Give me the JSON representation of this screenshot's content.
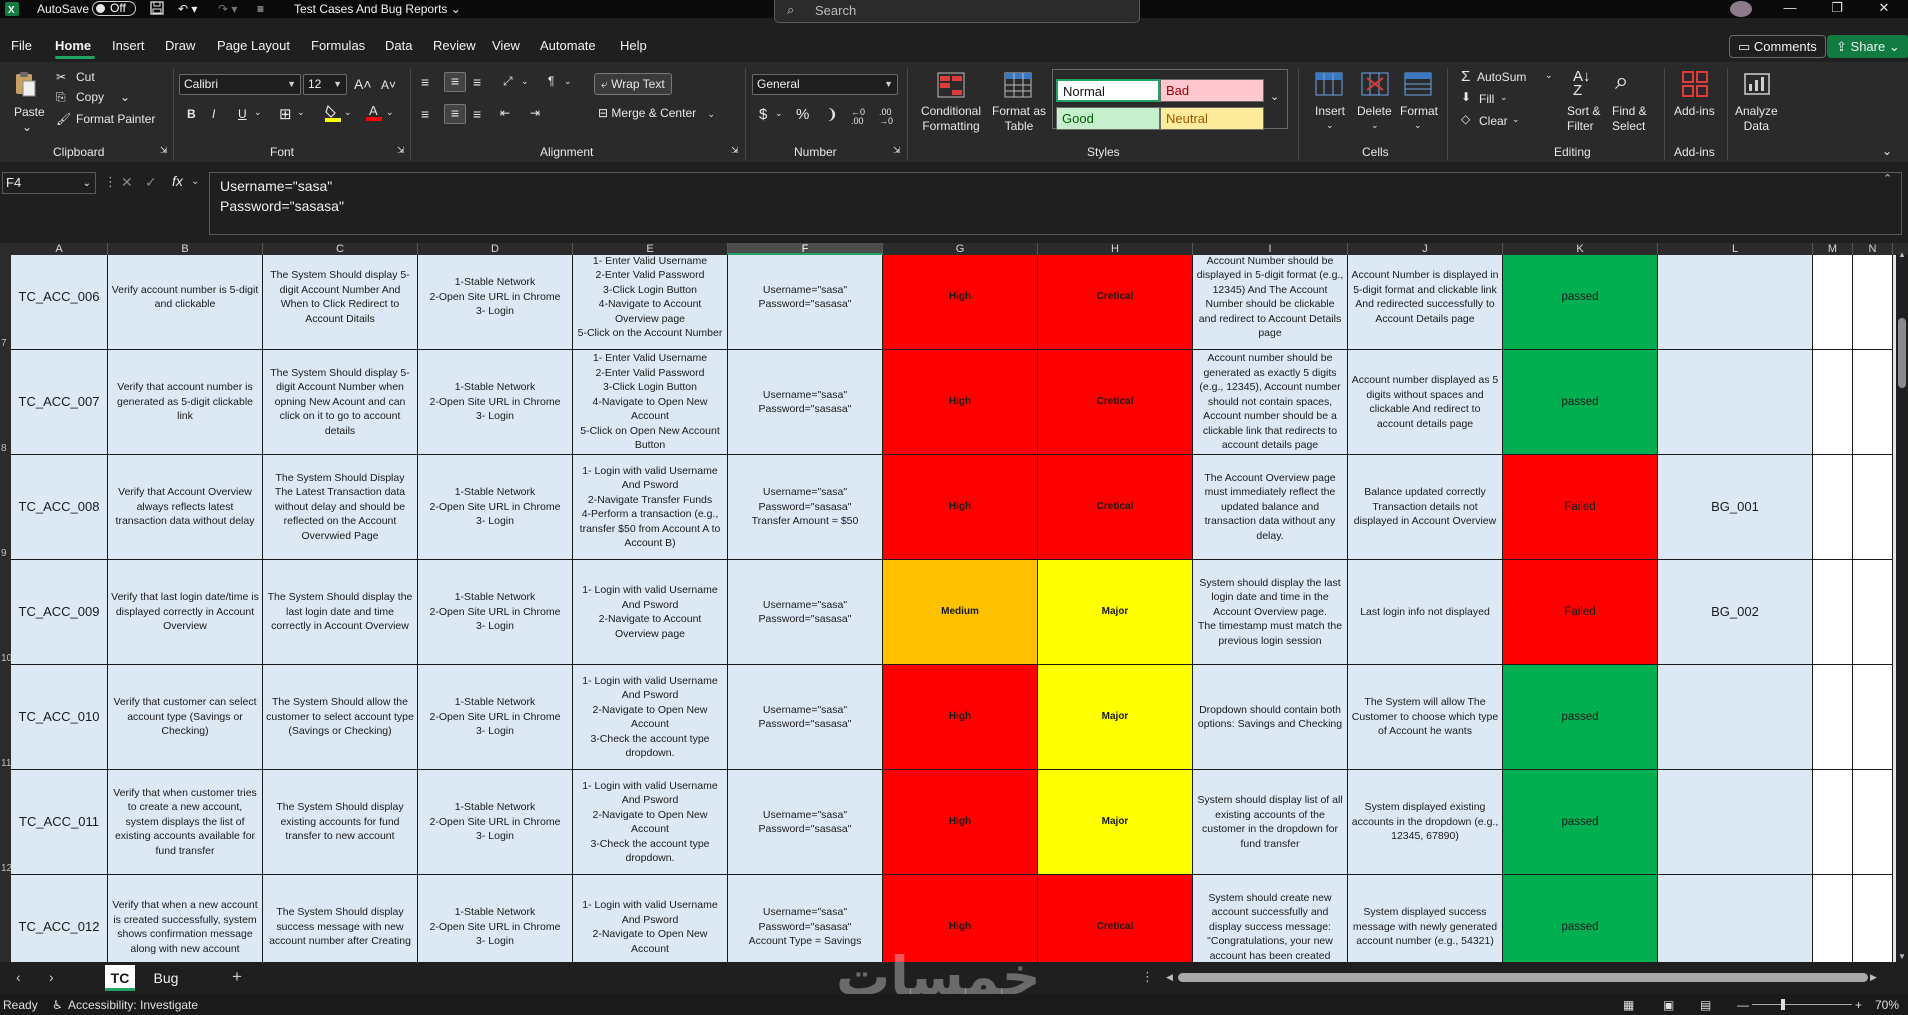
{
  "titlebar": {
    "autosave_label": "AutoSave",
    "autosave_state": "Off",
    "doc_title": "Test Cases And Bug Reports",
    "search_placeholder": "Search"
  },
  "menu": {
    "tabs": [
      "File",
      "Home",
      "Insert",
      "Draw",
      "Page Layout",
      "Formulas",
      "Data",
      "Review",
      "View",
      "Automate",
      "Help"
    ],
    "active": "Home",
    "comments_label": "Comments",
    "share_label": "Share"
  },
  "ribbon": {
    "clipboard": {
      "paste": "Paste",
      "cut": "Cut",
      "copy": "Copy",
      "format_painter": "Format Painter",
      "group": "Clipboard"
    },
    "font": {
      "family": "Calibri",
      "size": "12",
      "group": "Font"
    },
    "alignment": {
      "wrap_text": "Wrap Text",
      "merge_center": "Merge & Center",
      "group": "Alignment"
    },
    "number": {
      "format": "General",
      "group": "Number"
    },
    "styles": {
      "conditional": "Conditional\nFormatting",
      "format_table": "Format as\nTable",
      "normal": "Normal",
      "bad": "Bad",
      "good": "Good",
      "neutral": "Neutral",
      "group": "Styles"
    },
    "cells": {
      "insert": "Insert",
      "delete": "Delete",
      "format": "Format",
      "group": "Cells"
    },
    "editing": {
      "autosum": "AutoSum",
      "fill": "Fill",
      "clear": "Clear",
      "sort_filter": "Sort &\nFilter",
      "find_select": "Find &\nSelect",
      "group": "Editing"
    },
    "addins": {
      "addins": "Add-ins",
      "group": "Add-ins"
    },
    "analyze": {
      "label": "Analyze\nData"
    }
  },
  "formula": {
    "namebox": "F4",
    "line1": "Username=\"sasa\"",
    "line2": "Password=\"sasasa\""
  },
  "columns": [
    "A",
    "B",
    "C",
    "D",
    "E",
    "F",
    "G",
    "H",
    "I",
    "J",
    "K",
    "L",
    "M",
    "N"
  ],
  "selected_column": "F",
  "rows": [
    {
      "id": "TC_ACC_006",
      "title": "Verify account number is 5-digit and clickable",
      "desc": "The System Should display 5-digit Account Number And When to Click Redirect to Account Ditails",
      "pre": "1-Stable Network\n2-Open Site URL in Chrome\n3- Login",
      "steps": "1- Enter Valid Username\n2-Enter Valid Password\n3-Click Login Button\n4-Navigate to Account Overview page\n5-Click on the Account Number",
      "data": "Username=\"sasa\"\nPassword=\"sasasa\"",
      "priority": "High",
      "severity": "Cretical",
      "expected": "Account Number should be displayed in 5-digit format (e.g., 12345) And The Account Number should be clickable and redirect to Account Details page",
      "actual": "Account Number is displayed in 5-digit format and clickable link And redirected successfully to Account Details page",
      "status": "passed",
      "bug": ""
    },
    {
      "id": "TC_ACC_007",
      "title": "Verify that account number is generated as 5-digit clickable link",
      "desc": "The System Should display 5-digit Account Number when opning New Acount and can click on it to go to account details",
      "pre": "1-Stable Network\n2-Open Site URL in Chrome\n3- Login",
      "steps": "1- Enter Valid Username\n2-Enter Valid Password\n3-Click Login Button\n4-Navigate to Open New Account\n5-Click on Open New Account Button",
      "data": "Username=\"sasa\"\nPassword=\"sasasa\"",
      "priority": "High",
      "severity": "Cretical",
      "expected": "Account number should be generated as exactly 5 digits (e.g., 12345), Account number should not contain spaces, Account number should be a clickable link that redirects to account details page",
      "actual": "Account number displayed as 5 digits without spaces and clickable And redirect to account details page",
      "status": "passed",
      "bug": ""
    },
    {
      "id": "TC_ACC_008",
      "title": "Verify that Account Overview always reflects latest transaction data without delay",
      "desc": "The System Should Display The Latest Transaction data without delay and should be reflected on the Account Overvwied Page",
      "pre": "1-Stable Network\n2-Open Site URL in Chrome\n3- Login",
      "steps": "1- Login with valid Username And Psword\n2-Navigate Transfer Funds\n4-Perform a transaction (e.g., transfer $50 from Account A to Account B)",
      "data": "Username=\"sasa\"\nPassword=\"sasasa\"\nTransfer Amount = $50",
      "priority": "High",
      "severity": "Cretical",
      "expected": "The Account Overview page must immediately reflect the updated balance and transaction data without any delay.",
      "actual": "Balance updated correctly Transaction details not displayed in Account Overview",
      "status": "Failed",
      "bug": "BG_001"
    },
    {
      "id": "TC_ACC_009",
      "title": "Verify that last login date/time is displayed correctly in Account Overview",
      "desc": "The System Should display the last login date and time correctly in Account Overview",
      "pre": "1-Stable Network\n2-Open Site URL in Chrome\n3- Login",
      "steps": "1- Login with valid Username And Psword\n2-Navigate to Account Overview page",
      "data": "Username=\"sasa\"\nPassword=\"sasasa\"",
      "priority": "Medium",
      "severity": "Major",
      "expected": "System should display the last login date and time in the Account Overview page.\nThe timestamp must match the previous login session",
      "actual": "Last login info not displayed",
      "status": "Failed",
      "bug": "BG_002"
    },
    {
      "id": "TC_ACC_010",
      "title": "Verify that customer can select account type (Savings or Checking)",
      "desc": "The System Should allow the customer to select account type (Savings or Checking)",
      "pre": "1-Stable Network\n2-Open Site URL in Chrome\n3- Login",
      "steps": "1- Login with valid Username And Psword\n2-Navigate to Open New Account\n3-Check the account type dropdown.",
      "data": "Username=\"sasa\"\nPassword=\"sasasa\"",
      "priority": "High",
      "severity": "Major",
      "expected": "Dropdown should contain both options: Savings and Checking",
      "actual": "The System will allow The Customer to choose which type of Account he wants",
      "status": "passed",
      "bug": ""
    },
    {
      "id": "TC_ACC_011",
      "title": "Verify that when customer tries to create a new account, system displays the list of existing accounts available for fund transfer",
      "desc": "The System Should display existing accounts for fund transfer to new account",
      "pre": "1-Stable Network\n2-Open Site URL in Chrome\n3- Login",
      "steps": "1- Login with valid Username And Psword\n2-Navigate to Open New Account\n3-Check the account type dropdown.",
      "data": "Username=\"sasa\"\nPassword=\"sasasa\"",
      "priority": "High",
      "severity": "Major",
      "expected": "System should display list of all existing accounts of the customer in the dropdown for fund transfer",
      "actual": "System displayed existing accounts in the dropdown (e.g., 12345, 67890)",
      "status": "passed",
      "bug": ""
    },
    {
      "id": "TC_ACC_012",
      "title": "Verify that when a new account is created successfully, system shows confirmation message along with new account",
      "desc": "The System Should display success message with new account number after Creating",
      "pre": "1-Stable Network\n2-Open Site URL in Chrome\n3- Login",
      "steps": "1- Login with valid Username And Psword\n2-Navigate to Open New Account",
      "data": "Username=\"sasa\"\nPassword=\"sasasa\"\nAccount Type = Savings",
      "priority": "High",
      "severity": "Cretical",
      "expected": "System should create new account successfully and display success message: \"Congratulations, your new account has been created",
      "actual": "System displayed success message with newly generated account number (e.g., 54321)",
      "status": "passed",
      "bug": ""
    }
  ],
  "row_numbers": [
    "7",
    "8",
    "9",
    "10",
    "11",
    "12"
  ],
  "sheets": {
    "tabs": [
      "TC",
      "Bug"
    ],
    "active": "TC"
  },
  "statusbar": {
    "ready": "Ready",
    "accessibility": "Accessibility: Investigate",
    "zoom": "70%"
  },
  "watermark": "خمسات",
  "colors": {
    "high": "#ff0000",
    "medium": "#ffc000",
    "critical": "#ff0000",
    "major": "#ffff00",
    "passed": "#00b050",
    "failed": "#ff0000",
    "cell_bg": "#dce9f5",
    "accent": "#21a366"
  }
}
